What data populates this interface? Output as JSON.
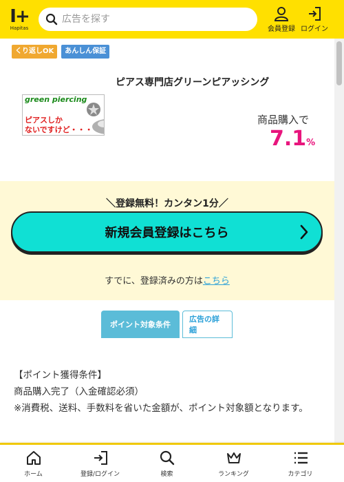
{
  "header": {
    "logo_mark": "I+",
    "logo_text": "Hapitas",
    "search_placeholder": "広告を探す",
    "register_label": "会員登録",
    "login_label": "ログイン"
  },
  "badges": [
    "くり返しOK",
    "あんしん保証"
  ],
  "product": {
    "name": "ピアス専門店グリーンピアッシング",
    "image_brand": "green piercing",
    "image_line1": "ピアスしか",
    "image_line2": "ないですけど・・・",
    "reward_label": "商品購入で",
    "reward_value": "7.1",
    "reward_unit": "%"
  },
  "registration": {
    "catch": "＼登録無料！カンタン1分／",
    "button_label": "新規会員登録はこちら",
    "login_prefix": "すでに、登録済みの方は",
    "login_link": "こちら"
  },
  "tabs": [
    {
      "label": "ポイント対象条件",
      "active": true
    },
    {
      "label": "広告の詳細",
      "active": false
    }
  ],
  "conditions": {
    "heading": "【ポイント獲得条件】",
    "line1": "商品購入完了（入金確認必須）",
    "line2": "※消費税、送料、手数料を省いた金額が、ポイント対象額となります。"
  },
  "bottom_nav": [
    {
      "label": "ホーム",
      "icon": "home-icon"
    },
    {
      "label": "登録/ログイン",
      "icon": "login-icon"
    },
    {
      "label": "検索",
      "icon": "search-icon"
    },
    {
      "label": "ランキング",
      "icon": "crown-icon"
    },
    {
      "label": "カテゴリ",
      "icon": "list-icon"
    }
  ],
  "colors": {
    "brand_yellow": "#ffe000",
    "reward_pink": "#e8157d",
    "cta_cyan": "#10e0d4",
    "tab_blue": "#5bbcd8",
    "link_blue": "#2aa0d8"
  }
}
